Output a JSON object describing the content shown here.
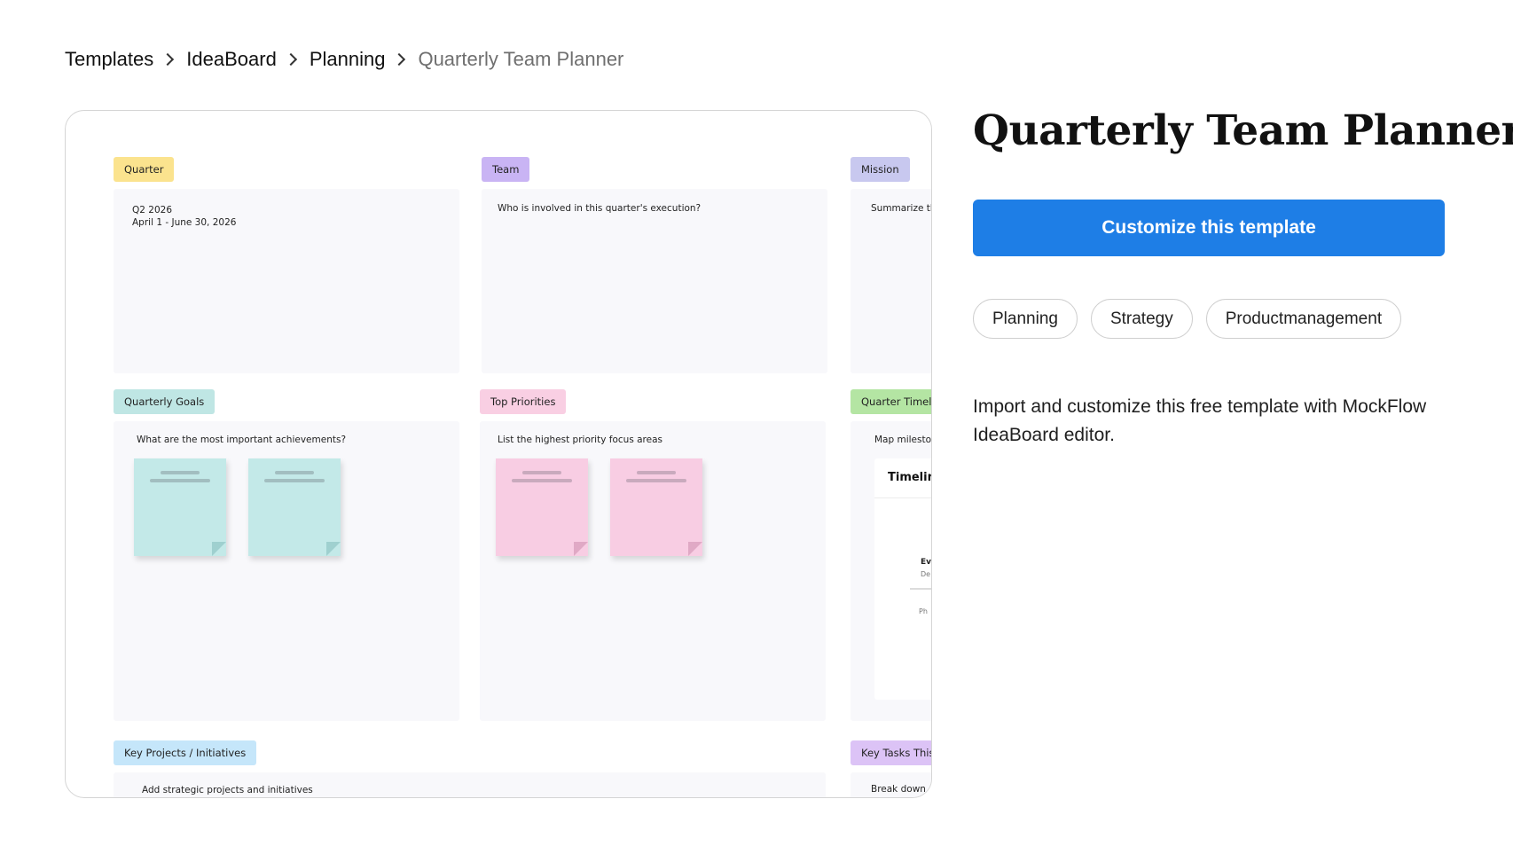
{
  "breadcrumb": [
    "Templates",
    "IdeaBoard",
    "Planning",
    "Quarterly Team Planner"
  ],
  "board": {
    "quarter_tag": "Quarter",
    "quarter_line1": "Q2 2026",
    "quarter_line2": "April 1 - June 30, 2026",
    "team_tag": "Team",
    "team_text": "Who is involved in this quarter's execution?",
    "mission_tag": "Mission",
    "mission_text": "Summarize the",
    "goals_tag": "Quarterly Goals",
    "goals_text": "What are the most important achievements?",
    "priorities_tag": "Top Priorities",
    "priorities_text": "List the highest priority focus areas",
    "timeline_tag": "Quarter Timelin",
    "timeline_text": "Map milestone",
    "timeline_card_title": "Timelin",
    "timeline_event": "Ev",
    "timeline_event_date": "De",
    "timeline_phase": "Ph",
    "projects_tag": "Key Projects / Initiatives",
    "projects_text": "Add strategic projects and initiatives",
    "tasks_tag": "Key Tasks This Q",
    "tasks_text": "Break down a"
  },
  "tag_colors": {
    "yellow": "#fbe38e",
    "purple": "#c9b4f4",
    "lavender": "#c8c8ef",
    "teal": "#bfe6e4",
    "pink": "#f9cfe3",
    "green": "#b4e5a3",
    "blue": "#c5e6fa",
    "violet": "#dcc3f6"
  },
  "title": "Quarterly Team Planner",
  "cta_label": "Customize this template",
  "cta_color": "#1e7ee6",
  "tags": [
    "Planning",
    "Strategy",
    "Productmanagement"
  ],
  "description": "Import and customize this free template with MockFlow IdeaBoard editor."
}
